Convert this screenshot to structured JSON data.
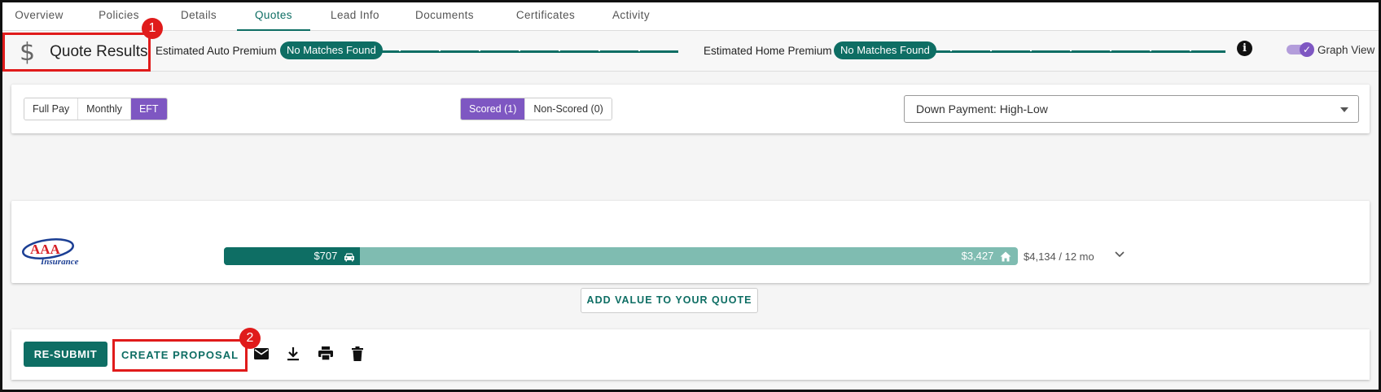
{
  "tabs": [
    {
      "label": "Overview"
    },
    {
      "label": "Policies"
    },
    {
      "label": "Details"
    },
    {
      "label": "Quotes",
      "active": true
    },
    {
      "label": "Lead Info"
    },
    {
      "label": "Documents"
    },
    {
      "label": "Certificates"
    },
    {
      "label": "Activity"
    }
  ],
  "results_bar": {
    "title": "Quote Results",
    "dollar_icon": "dollar-icon",
    "auto_label": "Estimated Auto Premium",
    "auto_status": "No Matches Found",
    "home_label": "Estimated Home Premium",
    "home_status": "No Matches Found",
    "graph_view_label": "Graph View",
    "graph_view_on": true
  },
  "filters": {
    "payment_modes": [
      "Full Pay",
      "Monthly",
      "EFT"
    ],
    "payment_selected": "EFT",
    "score_tabs": [
      "Scored (1)",
      "Non-Scored (0)"
    ],
    "score_selected": "Scored (1)",
    "sort_value": "Down Payment: High-Low"
  },
  "quote": {
    "carrier_logo_text": "AAA",
    "carrier_logo_sub": "Insurance",
    "auto_amount": "$707",
    "home_amount": "$3,427",
    "auto_value": 707,
    "home_value": 3427,
    "total": "$4,134 / 12 mo"
  },
  "add_value_label": "ADD VALUE TO YOUR QUOTE",
  "actions": {
    "resubmit": "RE-SUBMIT",
    "create_proposal": "CREATE PROPOSAL",
    "icons": [
      "email-icon",
      "download-icon",
      "print-icon",
      "delete-icon"
    ]
  },
  "callouts": [
    "1",
    "2"
  ],
  "colors": {
    "primary": "#0e6e64",
    "primary_light": "#7fbcb1",
    "accent": "#7e57c2",
    "callout": "#e01b1b"
  }
}
